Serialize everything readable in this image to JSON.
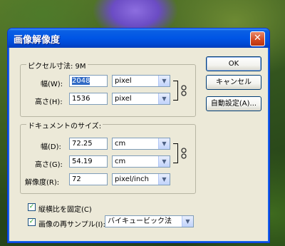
{
  "dialog": {
    "title": "画像解像度",
    "close_glyph": "✕"
  },
  "pixel_dimensions": {
    "label": "ピクセル寸法: 9M",
    "width_label": "幅(W):",
    "width_value": "2048",
    "width_unit": "pixel",
    "height_label": "高さ(H):",
    "height_value": "1536",
    "height_unit": "pixel"
  },
  "document_size": {
    "label": "ドキュメントのサイズ:",
    "width_label": "幅(D):",
    "width_value": "72.25",
    "width_unit": "cm",
    "height_label": "高さ(G):",
    "height_value": "54.19",
    "height_unit": "cm",
    "resolution_label": "解像度(R):",
    "resolution_value": "72",
    "resolution_unit": "pixel/inch"
  },
  "options": {
    "constrain_label": "縦横比を固定(C)",
    "constrain_checked": true,
    "resample_label": "画像の再サンプル(I):",
    "resample_checked": true,
    "resample_method": "バイキュービック法"
  },
  "buttons": {
    "ok": "OK",
    "cancel": "キャンセル",
    "auto": "自動設定(A)..."
  },
  "icons": {
    "dropdown": "▼",
    "chain": "chain-link-icon",
    "check": "✓"
  }
}
